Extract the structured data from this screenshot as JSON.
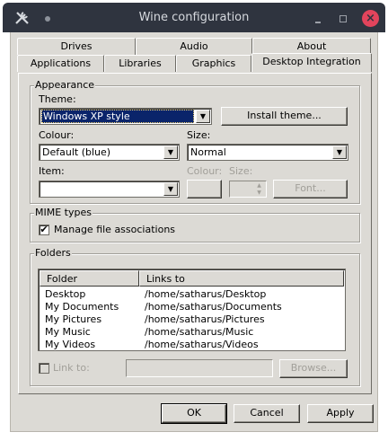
{
  "window": {
    "title": "Wine configuration"
  },
  "tabs_row1": [
    "Drives",
    "Audio",
    "About"
  ],
  "tabs_row2": [
    "Applications",
    "Libraries",
    "Graphics",
    "Desktop Integration"
  ],
  "appearance": {
    "group_label": "Appearance",
    "theme_label": "Theme:",
    "theme_value": "Windows XP style",
    "install_theme": "Install theme...",
    "colour_label": "Colour:",
    "colour_value": "Default (blue)",
    "size_label": "Size:",
    "size_value": "Normal",
    "item_label": "Item:",
    "item_value": "",
    "item_colour_label": "Colour:",
    "item_size_label": "Size:",
    "font_button": "Font..."
  },
  "mime": {
    "group_label": "MIME types",
    "manage_label": "Manage file associations",
    "manage_checked": true
  },
  "folders": {
    "group_label": "Folders",
    "columns": [
      "Folder",
      "Links to"
    ],
    "rows": [
      {
        "folder": "Desktop",
        "link": "/home/satharus/Desktop"
      },
      {
        "folder": "My Documents",
        "link": "/home/satharus/Documents"
      },
      {
        "folder": "My Pictures",
        "link": "/home/satharus/Pictures"
      },
      {
        "folder": "My Music",
        "link": "/home/satharus/Music"
      },
      {
        "folder": "My Videos",
        "link": "/home/satharus/Videos"
      }
    ],
    "link_to_label": "Link to:",
    "link_to_value": "",
    "browse_button": "Browse..."
  },
  "buttons": {
    "ok": "OK",
    "cancel": "Cancel",
    "apply": "Apply"
  }
}
